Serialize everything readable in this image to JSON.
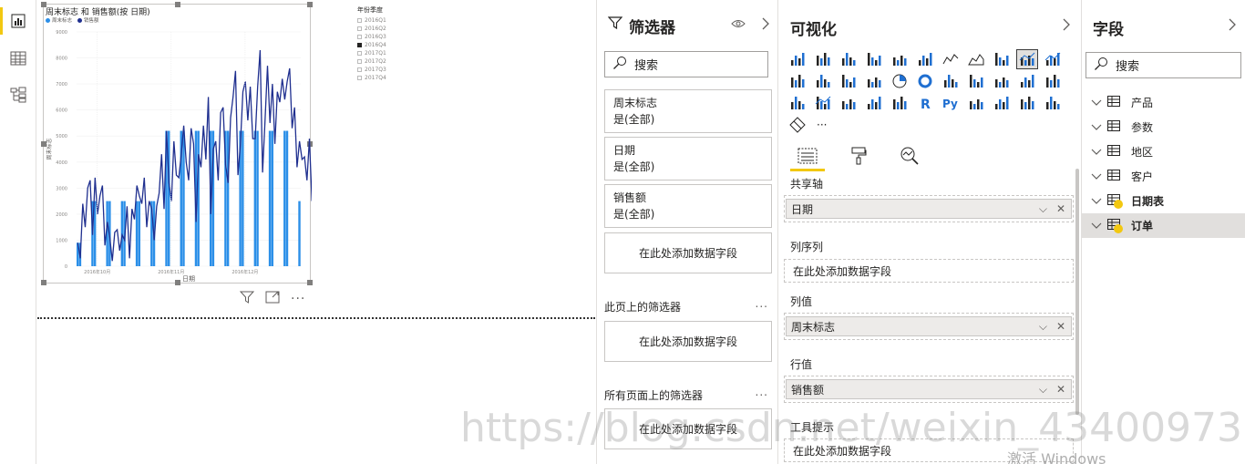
{
  "rail": {
    "items": [
      "report-view",
      "data-view",
      "model-view"
    ]
  },
  "visual": {
    "title": "周末标志 和 销售额(按 日期)",
    "legend": [
      {
        "name": "周末标志",
        "color": "#2b8fe8"
      },
      {
        "name": "销售额",
        "color": "#1f2f8f"
      }
    ]
  },
  "slicer": {
    "title": "年份季度",
    "items": [
      {
        "label": "2016Q1",
        "checked": false
      },
      {
        "label": "2016Q2",
        "checked": false
      },
      {
        "label": "2016Q3",
        "checked": false
      },
      {
        "label": "2016Q4",
        "checked": true
      },
      {
        "label": "2017Q1",
        "checked": false
      },
      {
        "label": "2017Q2",
        "checked": false
      },
      {
        "label": "2017Q3",
        "checked": false
      },
      {
        "label": "2017Q4",
        "checked": false
      }
    ]
  },
  "chart_data": {
    "type": "bar",
    "title": "周末标志 和 销售额(按 日期)",
    "xlabel": "日期",
    "ylabel": "周末标志",
    "ylim": [
      0,
      9000
    ],
    "y_ticks": [
      "0",
      "1000",
      "2000",
      "3000",
      "4000",
      "5000",
      "6000",
      "7000",
      "8000",
      "9000"
    ],
    "x_ticks": [
      "2016年10月",
      "2016年11月",
      "2016年12月"
    ],
    "legend_position": "top-left",
    "series": [
      {
        "name": "周末标志",
        "type": "bar",
        "color": "#2b8fe8",
        "values": [
          900,
          900,
          0,
          0,
          0,
          0,
          2500,
          2500,
          0,
          0,
          0,
          0,
          2500,
          2500,
          0,
          0,
          0,
          0,
          2500,
          2500,
          0,
          0,
          0,
          0,
          2500,
          2500,
          0,
          0,
          0,
          0,
          2500,
          2500,
          0,
          0,
          0,
          0,
          5200,
          5200,
          0,
          0,
          0,
          0,
          5200,
          5200,
          0,
          0,
          0,
          0,
          5200,
          5200,
          0,
          0,
          0,
          0,
          5200,
          5200,
          0,
          0,
          0,
          0,
          5200,
          5200,
          0,
          0,
          0,
          0,
          5200,
          5200,
          0,
          0,
          0,
          0,
          5200,
          5200,
          0,
          0,
          0,
          0,
          5200,
          5200,
          0,
          0,
          0,
          0,
          5200,
          5200,
          0,
          0,
          0,
          0,
          2500
        ]
      },
      {
        "name": "销售额",
        "type": "line",
        "color": "#1f2f8f",
        "values": [
          900,
          300,
          2400,
          1500,
          3000,
          3300,
          1200,
          3400,
          2000,
          2700,
          3100,
          800,
          1700,
          1100,
          200,
          1300,
          1400,
          600,
          1200,
          1000,
          2300,
          300,
          2200,
          1800,
          3100,
          2700,
          2400,
          3400,
          1500,
          2500,
          2200,
          1000,
          2300,
          2800,
          4300,
          2200,
          5200,
          3200,
          2500,
          4800,
          3500,
          3400,
          4300,
          5400,
          4000,
          3300,
          5300,
          4700,
          1700,
          4300,
          3800,
          5400,
          4100,
          6500,
          2000,
          4500,
          4800,
          3300,
          5900,
          6100,
          3900,
          3200,
          5700,
          6500,
          7500,
          3500,
          4700,
          6700,
          7100,
          5600,
          6900,
          4900,
          4900,
          6900,
          8300,
          3600,
          5600,
          7700,
          5500,
          7000,
          4700,
          6700,
          6300,
          7200,
          6400,
          7100,
          7600,
          5300,
          6100,
          3800,
          4800,
          4100,
          4200,
          3300,
          4900,
          2500
        ]
      }
    ]
  },
  "filters": {
    "title": "筛选器",
    "search_placeholder": "搜索",
    "cards": [
      {
        "name": "周末标志",
        "value": "是(全部)"
      },
      {
        "name": "日期",
        "value": "是(全部)"
      },
      {
        "name": "销售额",
        "value": "是(全部)"
      }
    ],
    "add_field": "在此处添加数据字段",
    "page_section": "此页上的筛选器",
    "all_pages_section": "所有页面上的筛选器",
    "more": "..."
  },
  "visualizations": {
    "title": "可视化",
    "more": "···",
    "wells": {
      "shared_axis": {
        "label": "共享轴",
        "value": "日期"
      },
      "column_series": {
        "label": "列序列",
        "placeholder": "在此处添加数据字段"
      },
      "column_values": {
        "label": "列值",
        "value": "周末标志"
      },
      "line_values": {
        "label": "行值",
        "value": "销售额"
      },
      "tooltips": {
        "label": "工具提示",
        "placeholder": "在此处添加数据字段"
      }
    }
  },
  "fields": {
    "title": "字段",
    "search_placeholder": "搜索",
    "tables": [
      {
        "name": "产品",
        "bold": false,
        "selected": false
      },
      {
        "name": "参数",
        "bold": false,
        "selected": false
      },
      {
        "name": "地区",
        "bold": false,
        "selected": false
      },
      {
        "name": "客户",
        "bold": false,
        "selected": false
      },
      {
        "name": "日期表",
        "bold": true,
        "selected": false
      },
      {
        "name": "订单",
        "bold": true,
        "selected": true
      }
    ]
  },
  "watermark": "https://blog.csdn.net/weixin_43400973",
  "activate_text": "激活 Windows"
}
